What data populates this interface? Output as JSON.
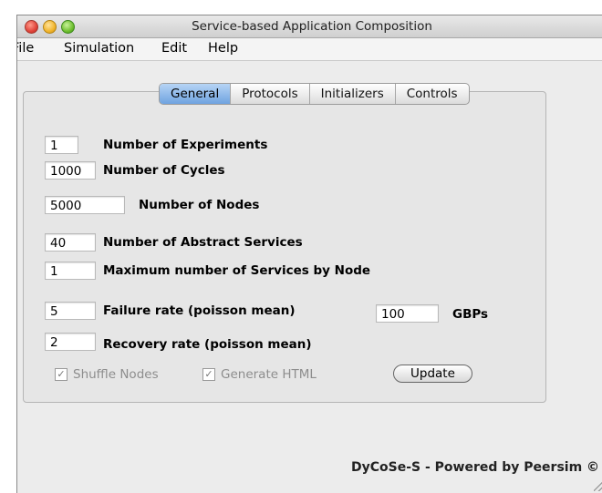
{
  "window": {
    "title": "Service-based Application Composition"
  },
  "menubar": [
    "File",
    "Simulation",
    "Edit",
    "Help"
  ],
  "tabs": [
    {
      "label": "General",
      "active": true
    },
    {
      "label": "Protocols",
      "active": false
    },
    {
      "label": "Initializers",
      "active": false
    },
    {
      "label": "Controls",
      "active": false
    }
  ],
  "general": {
    "experiments": {
      "value": "1",
      "label": "Number of Experiments"
    },
    "cycles": {
      "value": "1000",
      "label": "Number of Cycles"
    },
    "nodes": {
      "value": "5000",
      "label": "Number of Nodes"
    },
    "abstract_services": {
      "value": "40",
      "label": "Number of Abstract Services"
    },
    "max_services": {
      "value": "1",
      "label": "Maximum number of Services by Node"
    },
    "failure_rate": {
      "value": "5",
      "label": "Failure rate (poisson mean)"
    },
    "bandwidth": {
      "value": "100",
      "unit": "GBPs"
    },
    "recovery_rate": {
      "value": "2",
      "label": "Recovery rate (poisson mean)"
    },
    "shuffle_nodes": {
      "label": "Shuffle Nodes",
      "checked": true,
      "enabled": false
    },
    "generate_html": {
      "label": "Generate HTML",
      "checked": true,
      "enabled": false
    },
    "update_label": "Update"
  },
  "footer": "DyCoSe-S - Powered by Peersim ©"
}
